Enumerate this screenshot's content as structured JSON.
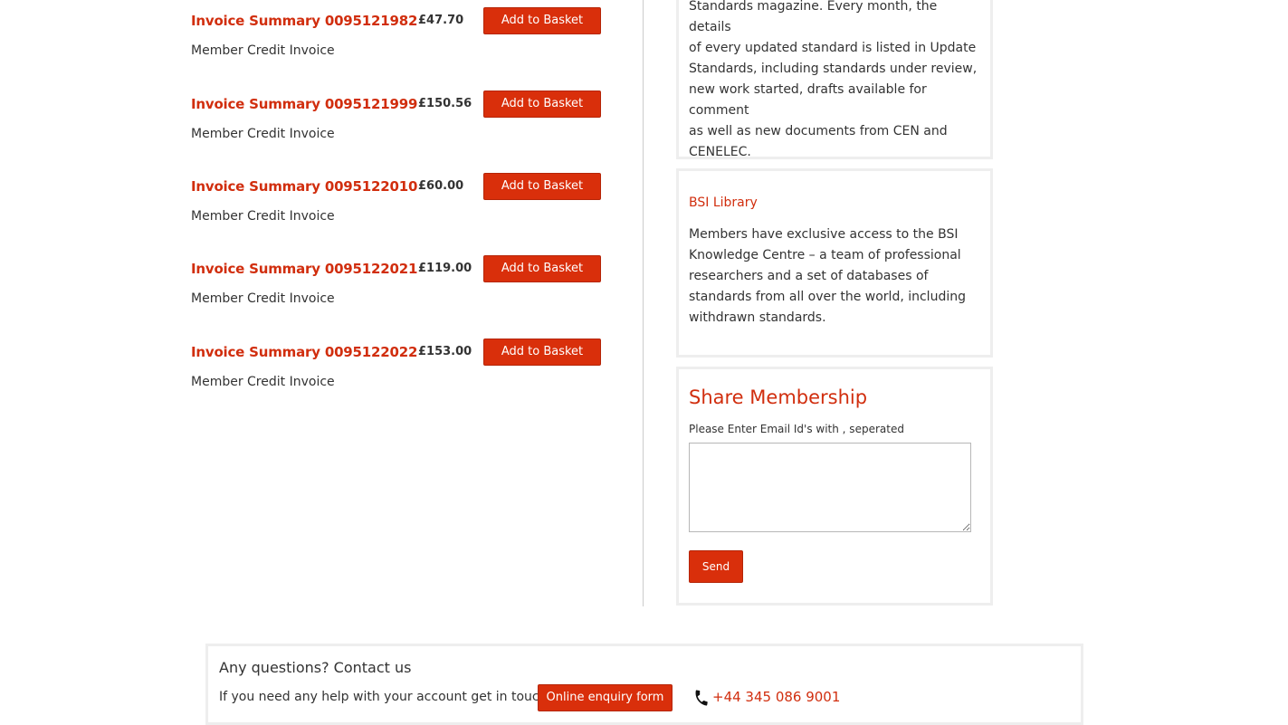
{
  "invoices": {
    "items": [
      {
        "title": "Invoice Summary 0095121982",
        "subtitle": "Member Credit Invoice",
        "price": "£47.70",
        "button_label": "Add to Basket"
      },
      {
        "title": "Invoice Summary 0095121999",
        "subtitle": "Member Credit Invoice",
        "price": "£150.56",
        "button_label": "Add to Basket"
      },
      {
        "title": "Invoice Summary 0095122010",
        "subtitle": "Member Credit Invoice",
        "price": "£60.00",
        "button_label": "Add to Basket"
      },
      {
        "title": "Invoice Summary 0095122021",
        "subtitle": "Member Credit Invoice",
        "price": "£119.00",
        "button_label": "Add to Basket"
      },
      {
        "title": "Invoice Summary 0095122022",
        "subtitle": "Member Credit Invoice",
        "price": "£153.00",
        "button_label": "Add to Basket"
      }
    ]
  },
  "sidebar": {
    "update_standards": {
      "lines": [
        "Standards magazine. Every month, the details",
        "of every updated standard is listed in Update",
        "Standards, including standards under review,",
        "new work started, drafts available for comment",
        "as well as new documents from CEN and",
        "CENELEC."
      ]
    },
    "bsi_library": {
      "link": "BSI Library",
      "lines": [
        "Members have exclusive access to the BSI",
        "Knowledge Centre – a team of professional",
        "researchers and a set of databases of",
        "standards from all over the world, including",
        "withdrawn standards."
      ]
    },
    "share_membership": {
      "heading": "Share Membership",
      "label": "Please Enter Email Id's with , seperated",
      "email_value": "",
      "send_label": "Send"
    }
  },
  "contact": {
    "title": "Any questions? Contact us",
    "text": "If you need any help with your account get in touch:",
    "enquiry_label": "Online enquiry form",
    "phone": "+44 345 086 9001",
    "phone_icon": "phone-icon"
  },
  "colors": {
    "accent": "#d12e0e",
    "button": "#d92f0b",
    "panel_border": "#eeeeee",
    "text": "#333333"
  }
}
